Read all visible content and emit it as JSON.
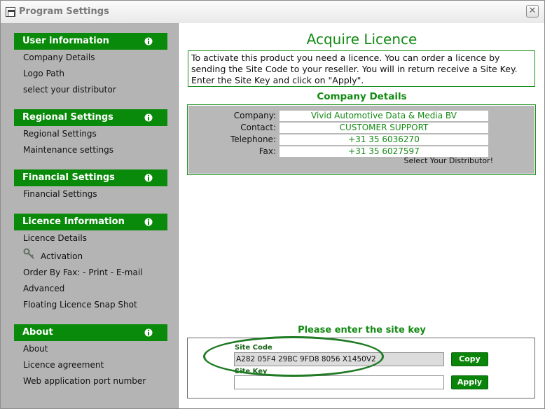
{
  "window": {
    "title": "Program Settings",
    "close_glyph": "✕"
  },
  "sidebar": {
    "sections": [
      {
        "header": "User information",
        "items": [
          "Company Details",
          "Logo Path",
          "select your distributor"
        ]
      },
      {
        "header": "Regional Settings",
        "items": [
          "Regional Settings",
          "Maintenance settings"
        ]
      },
      {
        "header": "Financial Settings",
        "items": [
          "Financial Settings"
        ]
      },
      {
        "header": "Licence Information",
        "items": [
          "Licence Details",
          "Activation",
          "Order By Fax: - Print - E-mail",
          "Advanced",
          "Floating Licence Snap Shot"
        ]
      },
      {
        "header": "About",
        "items": [
          "About",
          "Licence agreement",
          "Web application port number"
        ]
      }
    ],
    "header_icon": "info-icon"
  },
  "main": {
    "title": "Acquire Licence",
    "intro": "To activate this product you need a licence. You can order a licence by sending the Site Code to your reseller. You will in return receive a Site Key. Enter the Site Key and click on \"Apply\".",
    "company_details_title": "Company Details",
    "company": {
      "company_label": "Company:",
      "company_value": "Vivid Automotive Data & Media BV",
      "contact_label": "Contact:",
      "contact_value": "CUSTOMER SUPPORT",
      "telephone_label": "Telephone:",
      "telephone_value": "+31 35 6036270",
      "fax_label": "Fax:",
      "fax_value": "+31 35 6027597",
      "select_distributor": "Select Your Distributor!"
    },
    "site_key_section": {
      "title": "Please enter the site key",
      "site_code_label": "Site Code",
      "site_code_value": "A282 05F4 29BC 9FD8 8056 X1450V2",
      "copy_label": "Copy",
      "site_key_label": "Site Key",
      "site_key_value": "",
      "apply_label": "Apply"
    }
  },
  "colors": {
    "accent": "#0a8a0a",
    "sidebar_bg": "#b4b4b4",
    "highlight_ellipse": "#1f7a24"
  }
}
